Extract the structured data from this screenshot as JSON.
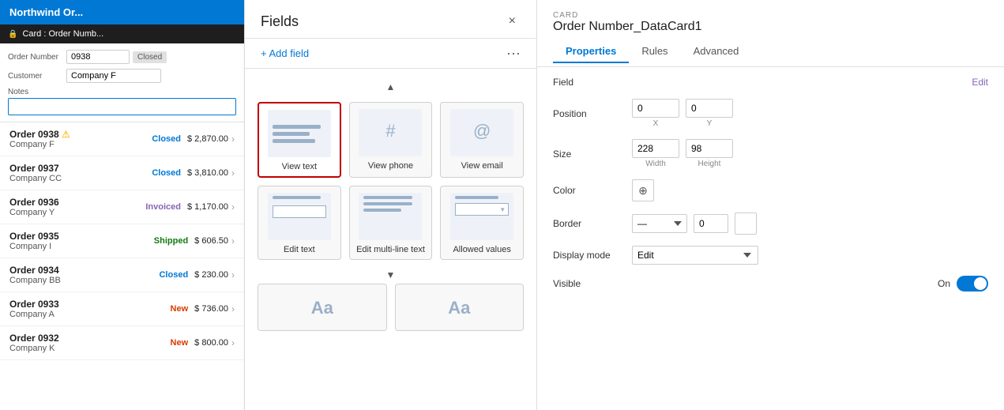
{
  "leftPanel": {
    "header": "Northwind Or...",
    "cardHeader": "Card : Order Numb...",
    "form": {
      "orderNumberLabel": "Order Number",
      "orderNumberValue": "0938",
      "orderStatusValue": "Closed",
      "customerLabel": "Customer",
      "customerValue": "Company F",
      "notesLabel": "Notes"
    },
    "orders": [
      {
        "id": "Order 0938",
        "warning": true,
        "status": "Closed",
        "statusClass": "status-closed",
        "company": "Company F",
        "amount": "$ 2,870.00"
      },
      {
        "id": "Order 0937",
        "warning": false,
        "status": "Closed",
        "statusClass": "status-closed",
        "company": "Company CC",
        "amount": "$ 3,810.00"
      },
      {
        "id": "Order 0936",
        "warning": false,
        "status": "Invoiced",
        "statusClass": "status-invoiced",
        "company": "Company Y",
        "amount": "$ 1,170.00"
      },
      {
        "id": "Order 0935",
        "warning": false,
        "status": "Shipped",
        "statusClass": "status-shipped",
        "company": "Company I",
        "amount": "$ 606.50"
      },
      {
        "id": "Order 0934",
        "warning": false,
        "status": "Closed",
        "statusClass": "status-closed",
        "company": "Company BB",
        "amount": "$ 230.00"
      },
      {
        "id": "Order 0933",
        "warning": false,
        "status": "New",
        "statusClass": "status-new",
        "company": "Company A",
        "amount": "$ 736.00"
      },
      {
        "id": "Order 0932",
        "warning": false,
        "status": "New",
        "statusClass": "status-new",
        "company": "Company K",
        "amount": "$ 800.00"
      }
    ]
  },
  "fieldsPanel": {
    "title": "Fields",
    "addFieldLabel": "+ Add field",
    "closeLabel": "×",
    "moreLabel": "···",
    "controls": [
      {
        "type": "view-text",
        "label": "View text",
        "selected": true
      },
      {
        "type": "view-phone",
        "label": "View phone",
        "selected": false
      },
      {
        "type": "view-email",
        "label": "View email",
        "selected": false
      },
      {
        "type": "edit-text",
        "label": "Edit text",
        "selected": false
      },
      {
        "type": "edit-multiline",
        "label": "Edit multi-line text",
        "selected": false
      },
      {
        "type": "allowed-values",
        "label": "Allowed values",
        "selected": false
      }
    ],
    "bottomControls": [
      {
        "type": "aa-1",
        "label": "Aa"
      },
      {
        "type": "aa-2",
        "label": "Aa"
      }
    ]
  },
  "rightPanel": {
    "label": "CARD",
    "title": "Order Number_DataCard1",
    "tabs": [
      "Properties",
      "Rules",
      "Advanced"
    ],
    "activeTab": "Properties",
    "properties": {
      "field": {
        "label": "Field",
        "editLabel": "Edit"
      },
      "position": {
        "label": "Position",
        "x": {
          "value": "0",
          "sub": "X"
        },
        "y": {
          "value": "0",
          "sub": "Y"
        }
      },
      "size": {
        "label": "Size",
        "width": {
          "value": "228",
          "sub": "Width"
        },
        "height": {
          "value": "98",
          "sub": "Height"
        }
      },
      "color": {
        "label": "Color"
      },
      "border": {
        "label": "Border",
        "value": "0"
      },
      "displayMode": {
        "label": "Display mode",
        "value": "Edit"
      },
      "visible": {
        "label": "Visible",
        "toggleLabel": "On"
      }
    }
  }
}
